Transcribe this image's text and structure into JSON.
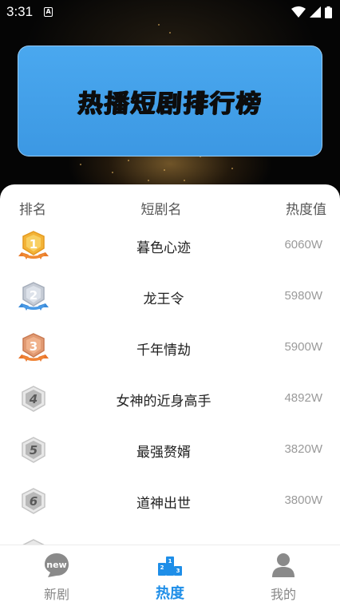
{
  "status_bar": {
    "time": "3:31",
    "notification_icon": "a-icon",
    "icons": [
      "wifi-icon",
      "signal-icon",
      "battery-icon"
    ]
  },
  "banner": {
    "title": "热播短剧排行榜"
  },
  "table": {
    "headers": {
      "rank": "排名",
      "name": "短剧名",
      "heat": "热度值"
    },
    "rows": [
      {
        "rank": "1",
        "title": "暮色心迹",
        "heat": "6060W",
        "badge": "gold-medal-icon"
      },
      {
        "rank": "2",
        "title": "龙王令",
        "heat": "5980W",
        "badge": "silver-medal-icon"
      },
      {
        "rank": "3",
        "title": "千年情劫",
        "heat": "5900W",
        "badge": "bronze-medal-icon"
      },
      {
        "rank": "4",
        "title": "女神的近身高手",
        "heat": "4892W",
        "badge": "rank-hexagon-icon"
      },
      {
        "rank": "5",
        "title": "最强赘婿",
        "heat": "3820W",
        "badge": "rank-hexagon-icon"
      },
      {
        "rank": "6",
        "title": "道神出世",
        "heat": "3800W",
        "badge": "rank-hexagon-icon"
      }
    ]
  },
  "bottom_nav": {
    "items": [
      {
        "label": "新剧",
        "icon": "new-icon",
        "badge_text": "new",
        "active": false
      },
      {
        "label": "热度",
        "icon": "podium-icon",
        "active": true
      },
      {
        "label": "我的",
        "icon": "user-icon",
        "active": false
      }
    ]
  },
  "colors": {
    "accent": "#1e8ee8",
    "banner": "#4aa8ef",
    "heat_text": "#9a9a9a"
  }
}
